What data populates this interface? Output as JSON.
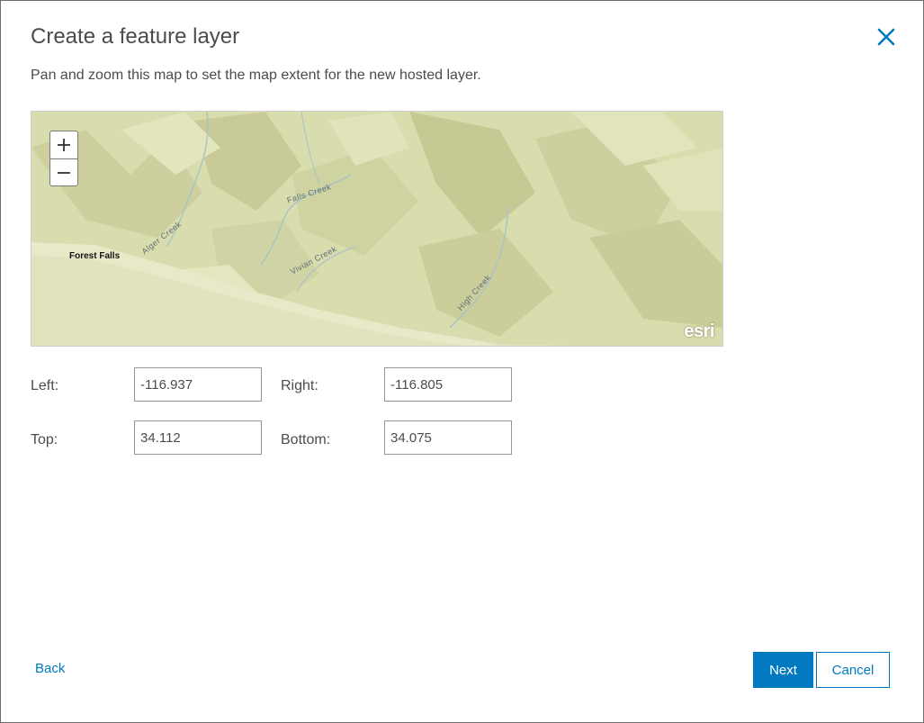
{
  "dialog": {
    "title": "Create a feature layer",
    "close_icon": "close-icon",
    "instructions": "Pan and zoom this map to set the map extent for the new hosted layer."
  },
  "map": {
    "zoom_in_label": "+",
    "zoom_out_label": "−",
    "labels": {
      "town": "Forest Falls",
      "alger_creek": "Alger Creek",
      "falls_creek": "Falls Creek",
      "vivian_creek": "Vivian Creek",
      "high_creek": "High Creek"
    },
    "attribution": "esri",
    "colors": {
      "terrain_base": "#d9dcac",
      "terrain_light": "#e6e8c0",
      "terrain_shadow": "#c2c592",
      "stream": "#a9c3c9"
    }
  },
  "extent": {
    "left_label": "Left:",
    "left_value": "-116.937",
    "right_label": "Right:",
    "right_value": "-116.805",
    "top_label": "Top:",
    "top_value": "34.112",
    "bottom_label": "Bottom:",
    "bottom_value": "34.075"
  },
  "footer": {
    "back_label": "Back",
    "next_label": "Next",
    "cancel_label": "Cancel"
  },
  "colors": {
    "accent": "#0079c1",
    "text": "#4c4c4c",
    "border": "#959595"
  }
}
